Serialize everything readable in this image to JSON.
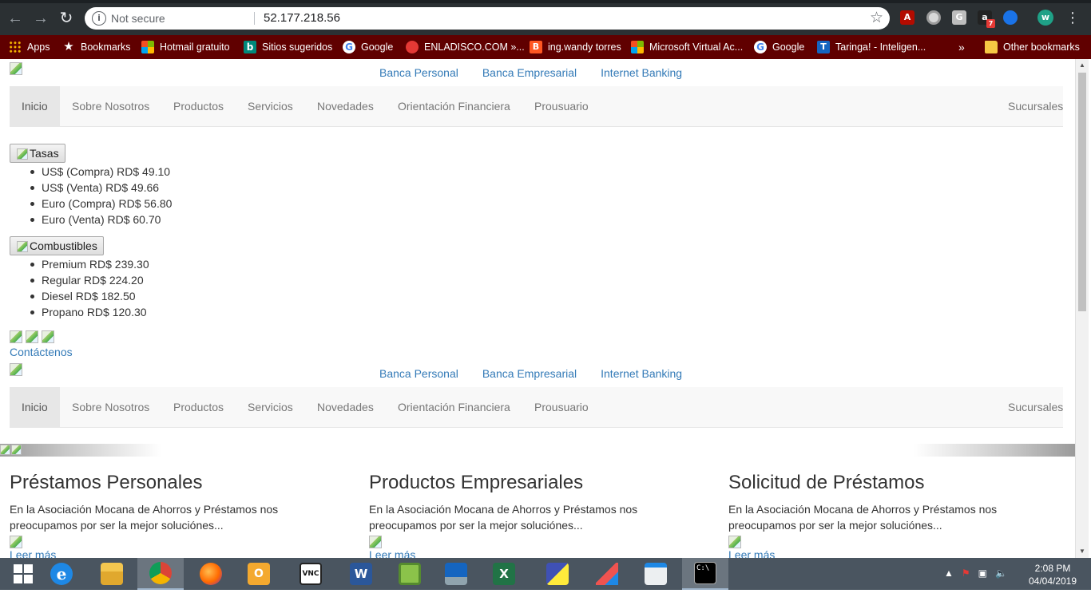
{
  "browser": {
    "security_label": "Not secure",
    "url": "52.177.218.56",
    "bookmarks": [
      {
        "label": "Apps",
        "icon": "apps-grid-icon"
      },
      {
        "label": "Bookmarks",
        "icon": "star-icon"
      },
      {
        "label": "Hotmail gratuito",
        "icon": "microsoft-icon"
      },
      {
        "label": "Sitios sugeridos",
        "icon": "bing-icon"
      },
      {
        "label": "Google",
        "icon": "google-icon"
      },
      {
        "label": "ENLADISCO.COM »...",
        "icon": "enladisco-icon"
      },
      {
        "label": "ing.wandy torres",
        "icon": "blogger-icon"
      },
      {
        "label": "Microsoft Virtual Ac...",
        "icon": "microsoft-icon"
      },
      {
        "label": "Google",
        "icon": "google-icon"
      },
      {
        "label": "Taringa! - Inteligen...",
        "icon": "taringa-icon"
      }
    ],
    "more_bookmarks": "»",
    "other_bookmarks": "Other bookmarks",
    "profile_initial": "w",
    "extension_badge": "7"
  },
  "page": {
    "top_links": [
      "Banca Personal",
      "Banca Empresarial",
      "Internet Banking"
    ],
    "nav": {
      "items": [
        "Inicio",
        "Sobre Nosotros",
        "Productos",
        "Servicios",
        "Novedades",
        "Orientación Financiera",
        "Prousuario"
      ],
      "right_item": "Sucursales"
    },
    "tasas": {
      "button_label": "Tasas",
      "items": [
        "US$ (Compra) RD$ 49.10",
        "US$ (Venta) RD$ 49.66",
        "Euro (Compra) RD$ 56.80",
        "Euro (Venta) RD$ 60.70"
      ]
    },
    "combustibles": {
      "button_label": "Combustibles",
      "items": [
        "Premium RD$ 239.30",
        "Regular RD$ 224.20",
        "Diesel RD$ 182.50",
        "Propano RD$ 120.30"
      ]
    },
    "contact_link": "Contáctenos",
    "cards": [
      {
        "title": "Préstamos Personales",
        "text": "En la Asociación Mocana de Ahorros y Préstamos nos preocupamos por ser la mejor soluciónes...",
        "more": "Leer más"
      },
      {
        "title": "Productos Empresariales",
        "text": "En la Asociación Mocana de Ahorros y Préstamos nos preocupamos por ser la mejor soluciónes...",
        "more": "Leer más"
      },
      {
        "title": "Solicitud de Préstamos",
        "text": "En la Asociación Mocana de Ahorros y Préstamos nos preocupamos por ser la mejor soluciónes...",
        "more": "Leer más"
      }
    ]
  },
  "taskbar": {
    "apps": [
      "start-icon",
      "internet-explorer-icon",
      "file-explorer-icon",
      "chrome-icon",
      "firefox-icon",
      "outlook-icon",
      "vnc-viewer-icon",
      "word-icon",
      "vsphere-icon",
      "remote-desktop-icon",
      "excel-icon",
      "network-setup-icon",
      "anydesk-icon",
      "control-panel-icon",
      "command-prompt-icon"
    ],
    "time": "2:08 PM",
    "date": "04/04/2019"
  },
  "colors": {
    "bookmark_bar": "#600000",
    "link": "#337ab7",
    "taskbar": "#4a5560"
  }
}
